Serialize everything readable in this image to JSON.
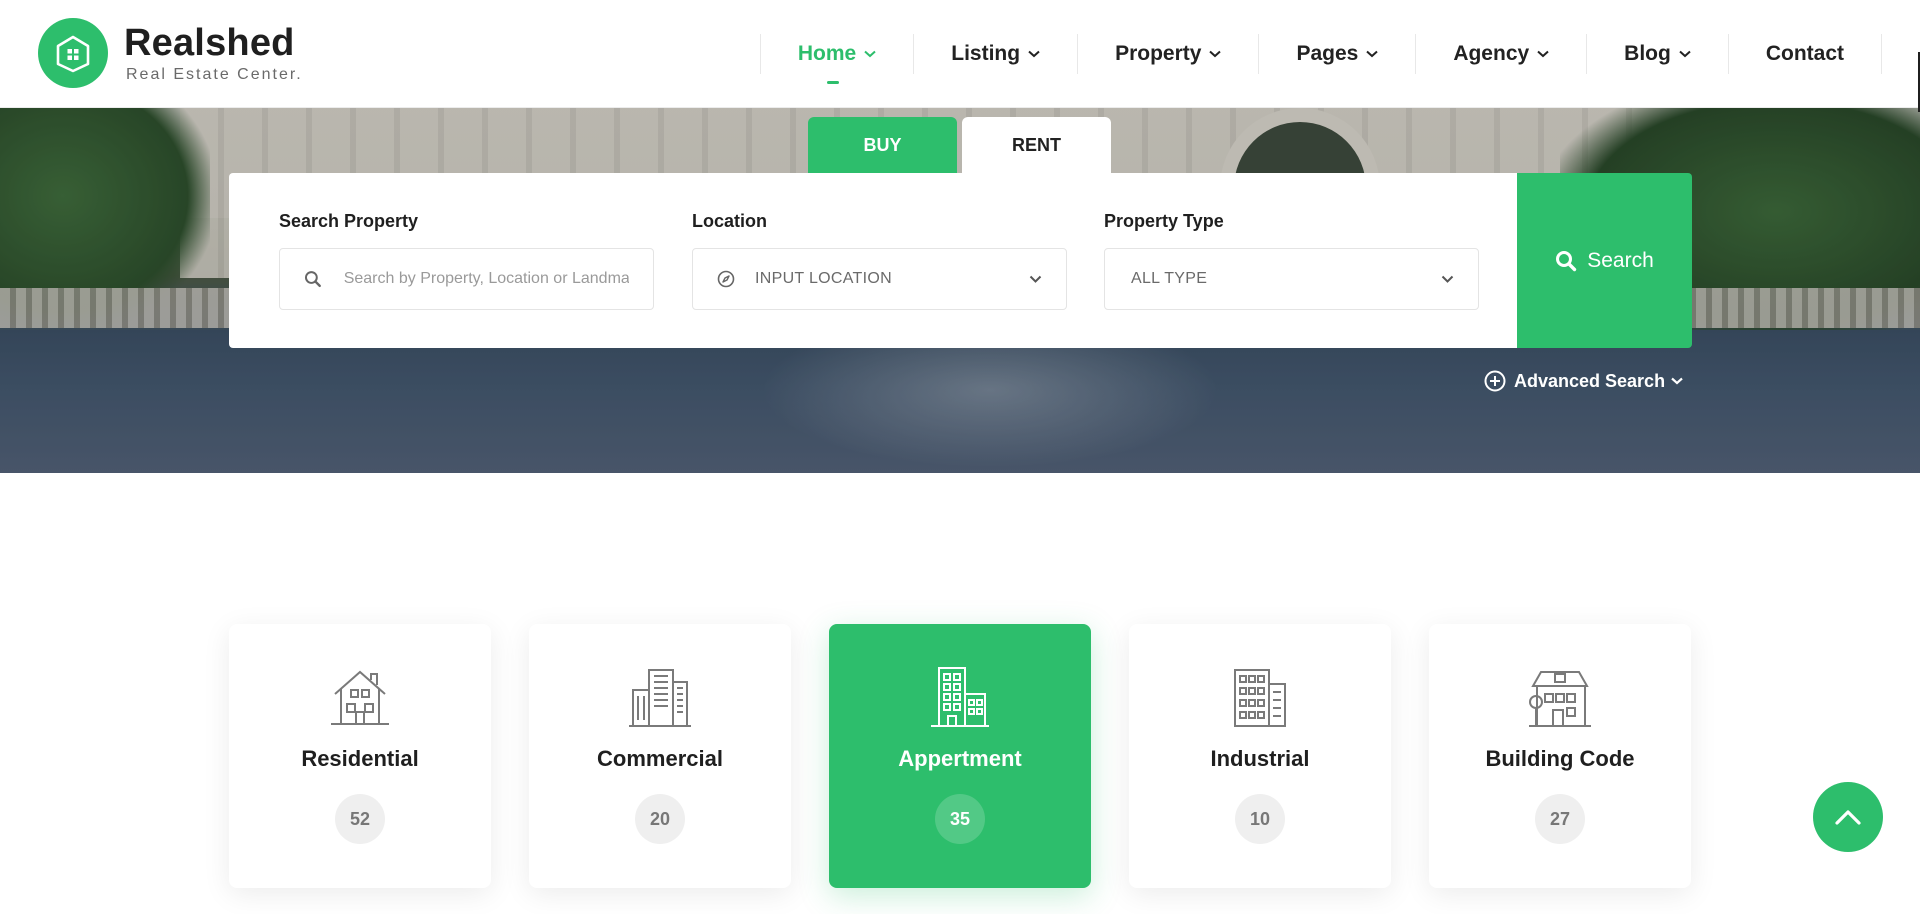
{
  "brand": {
    "title": "Realshed",
    "subtitle": "Real Estate Center.",
    "logo_icon": "house-icon",
    "accent_color": "#2dbe6c"
  },
  "nav": {
    "items": [
      {
        "label": "Home",
        "active": true,
        "dropdown": true
      },
      {
        "label": "Listing",
        "active": false,
        "dropdown": true
      },
      {
        "label": "Property",
        "active": false,
        "dropdown": true
      },
      {
        "label": "Pages",
        "active": false,
        "dropdown": true
      },
      {
        "label": "Agency",
        "active": false,
        "dropdown": true
      },
      {
        "label": "Blog",
        "active": false,
        "dropdown": true
      },
      {
        "label": "Contact",
        "active": false,
        "dropdown": false
      }
    ]
  },
  "search": {
    "tabs": [
      {
        "label": "BUY",
        "active": true
      },
      {
        "label": "RENT",
        "active": false
      }
    ],
    "fields": {
      "property": {
        "label": "Search Property",
        "placeholder": "Search by Property, Location or Landmark..."
      },
      "location": {
        "label": "Location",
        "value": "INPUT LOCATION"
      },
      "type": {
        "label": "Property Type",
        "value": "ALL TYPE"
      }
    },
    "button_label": "Search",
    "advanced_label": "Advanced Search"
  },
  "categories": [
    {
      "name": "Residential",
      "count": "52",
      "icon": "house-icon",
      "active": false
    },
    {
      "name": "Commercial",
      "count": "20",
      "icon": "office-building-icon",
      "active": false
    },
    {
      "name": "Appertment",
      "count": "35",
      "icon": "apartment-building-icon",
      "active": true
    },
    {
      "name": "Industrial",
      "count": "10",
      "icon": "industrial-building-icon",
      "active": false
    },
    {
      "name": "Building Code",
      "count": "27",
      "icon": "building-code-icon",
      "active": false
    }
  ]
}
